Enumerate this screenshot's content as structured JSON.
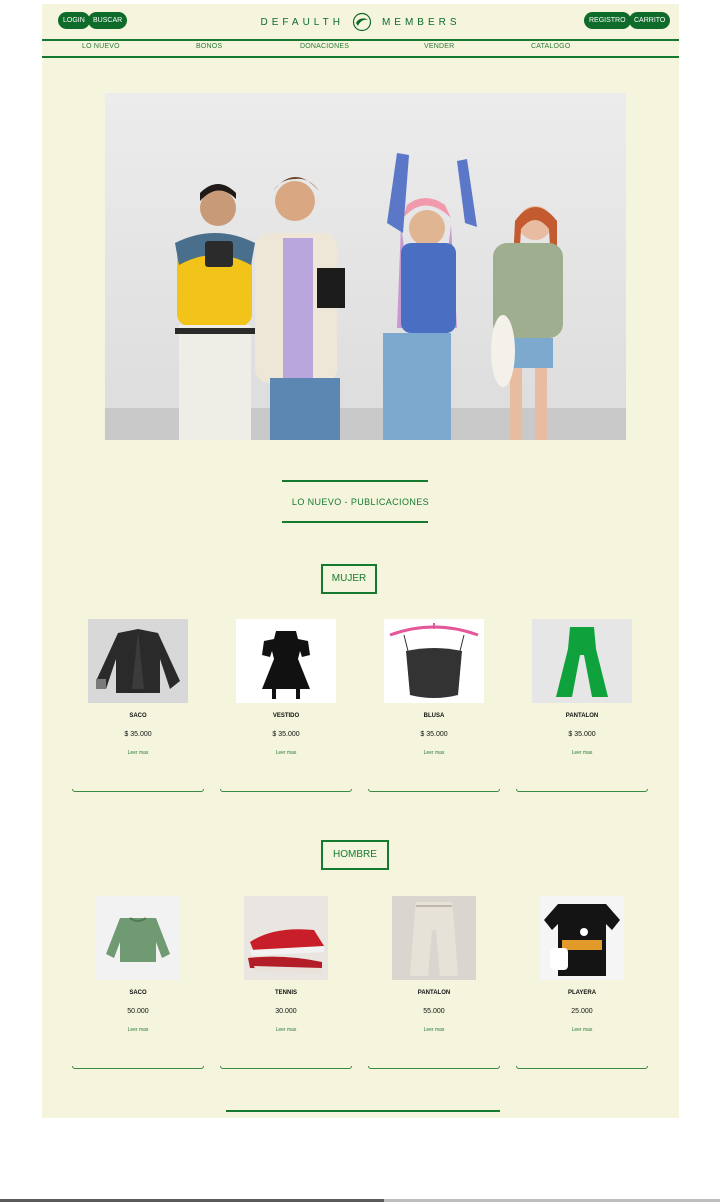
{
  "header": {
    "login_label": "LOGIN",
    "search_label": "BUSCAR",
    "logo_left": "DEFAULTH",
    "logo_right": "MEMBERS",
    "register_label": "REGISTRO",
    "cart_label": "CARRITO"
  },
  "nav": {
    "items": [
      {
        "label": "LO NUEVO"
      },
      {
        "label": "BONOS"
      },
      {
        "label": "DONACIONES"
      },
      {
        "label": "VENDER"
      },
      {
        "label": "CATALOGO"
      }
    ]
  },
  "section": {
    "title": "LO NUEVO - PUBLICACIONES"
  },
  "women": {
    "category": "MUJER",
    "products": [
      {
        "name": "SACO",
        "price": "$ 35.000",
        "more": "Leer mas"
      },
      {
        "name": "VESTIDO",
        "price": "$ 35.000",
        "more": "Leer mas"
      },
      {
        "name": "BLUSA",
        "price": "$ 35.000",
        "more": "Leer mas"
      },
      {
        "name": "PANTALON",
        "price": "$ 35.000",
        "more": "Leer mas"
      }
    ]
  },
  "men": {
    "category": "HOMBRE",
    "products": [
      {
        "name": "SACO",
        "price": "50.000",
        "more": "Leer mas"
      },
      {
        "name": "TENNIS",
        "price": "30.000",
        "more": "Leer mas"
      },
      {
        "name": "PANTALON",
        "price": "55.000",
        "more": "Leer mas"
      },
      {
        "name": "PLAYERA",
        "price": "25.000",
        "more": "Leer mas"
      }
    ]
  },
  "colors": {
    "brand_green": "#0f6b2a",
    "page_bg": "#f4f5dc"
  }
}
